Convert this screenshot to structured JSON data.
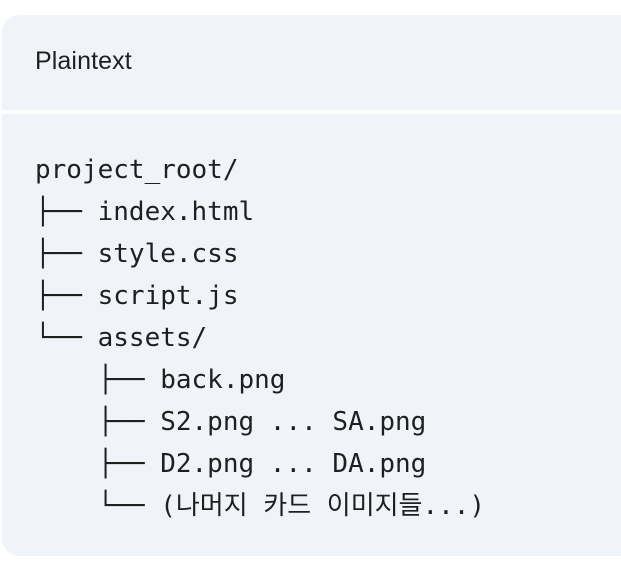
{
  "code_block": {
    "language_label": "Plaintext",
    "lines": [
      "project_root/",
      "├── index.html",
      "├── style.css",
      "├── script.js",
      "└── assets/",
      "    ├── back.png",
      "    ├── S2.png ... SA.png",
      "    ├── D2.png ... DA.png",
      "    └── (나머지 카드 이미지들...)"
    ]
  }
}
